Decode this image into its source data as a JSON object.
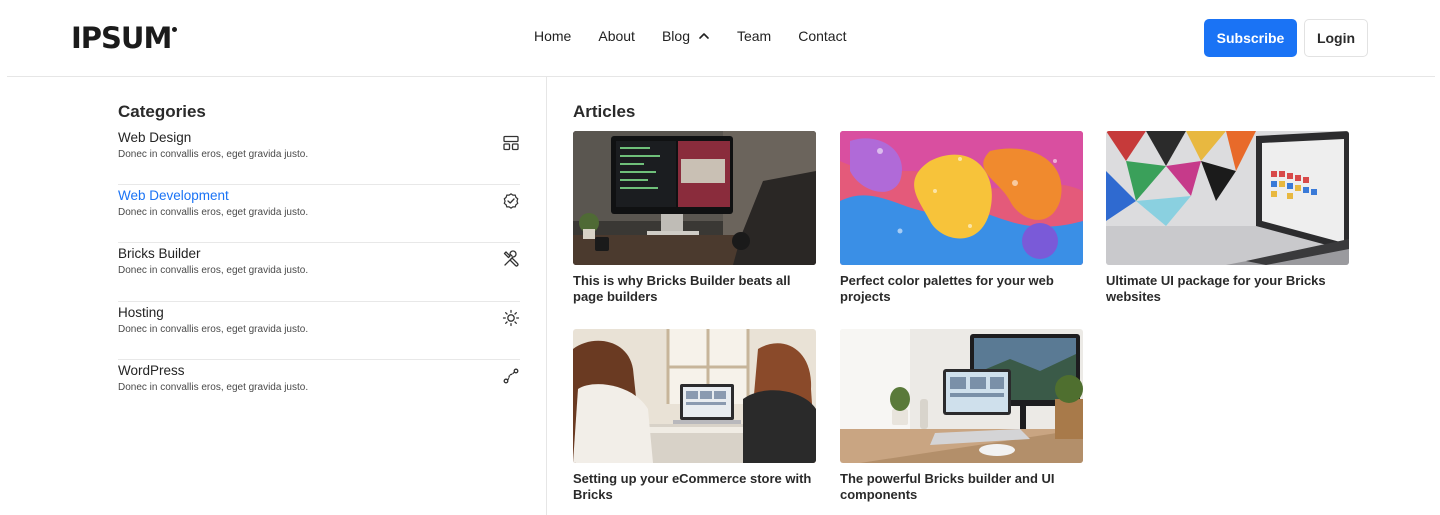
{
  "brand": {
    "logo_text": "IPSUM"
  },
  "nav": {
    "items": [
      "Home",
      "About",
      "Blog",
      "Team",
      "Contact"
    ]
  },
  "actions": {
    "subscribe": "Subscribe",
    "login": "Login"
  },
  "colors": {
    "accent": "#1a73f5",
    "text": "#242424",
    "divider": "#e6e6e6"
  },
  "categories": {
    "title": "Categories",
    "items": [
      {
        "name": "Web Design",
        "desc": "Donec in convallis eros, eget gravida justo.",
        "icon": "layout-icon"
      },
      {
        "name": "Web Development",
        "desc": "Donec in convallis eros, eget gravida justo.",
        "icon": "badge-check-icon",
        "active": true
      },
      {
        "name": "Bricks Builder",
        "desc": "Donec in convallis eros, eget gravida justo.",
        "icon": "tools-icon"
      },
      {
        "name": "Hosting",
        "desc": "Donec in convallis eros, eget gravida justo.",
        "icon": "sun-icon"
      },
      {
        "name": "WordPress",
        "desc": "Donec in convallis eros, eget gravida justo.",
        "icon": "route-icon"
      }
    ]
  },
  "articles": {
    "title": "Articles",
    "items": [
      {
        "title": "This is why Bricks Builder beats all page builders"
      },
      {
        "title": "Perfect color palettes for your web projects"
      },
      {
        "title": "Ultimate UI package for your Bricks websites"
      },
      {
        "title": "Setting up your eCommerce store with Bricks"
      },
      {
        "title": "The powerful Bricks builder and UI components"
      }
    ]
  }
}
